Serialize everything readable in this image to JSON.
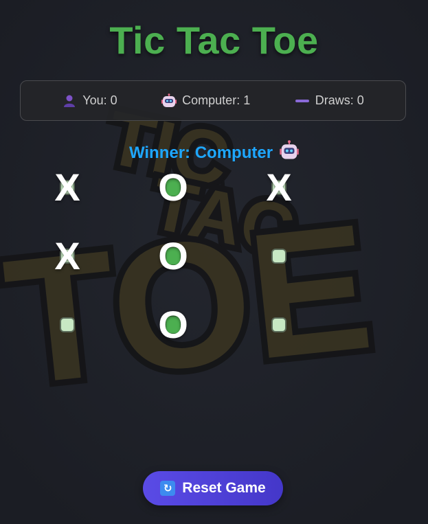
{
  "title": "Tic Tac Toe",
  "scores": [
    {
      "icon": "person-icon",
      "label": "You: 0"
    },
    {
      "icon": "robot-icon",
      "label": "Computer: 1"
    },
    {
      "icon": "dash-icon",
      "label": "Draws: 0"
    }
  ],
  "status": {
    "text": "Winner: Computer",
    "icon": "robot-icon",
    "color": "#1ea7ff"
  },
  "board": {
    "cells": [
      "X",
      "O",
      "X",
      "X",
      "O",
      "",
      "",
      "O",
      ""
    ]
  },
  "reset_button": {
    "icon": "refresh-icon",
    "label": "Reset Game"
  },
  "background_logo": {
    "lines": [
      "TIC",
      "TAC",
      "TOE"
    ]
  },
  "colors": {
    "title": "#4caf50",
    "accent_button": "#5a4be6",
    "background": "#1f2128"
  }
}
